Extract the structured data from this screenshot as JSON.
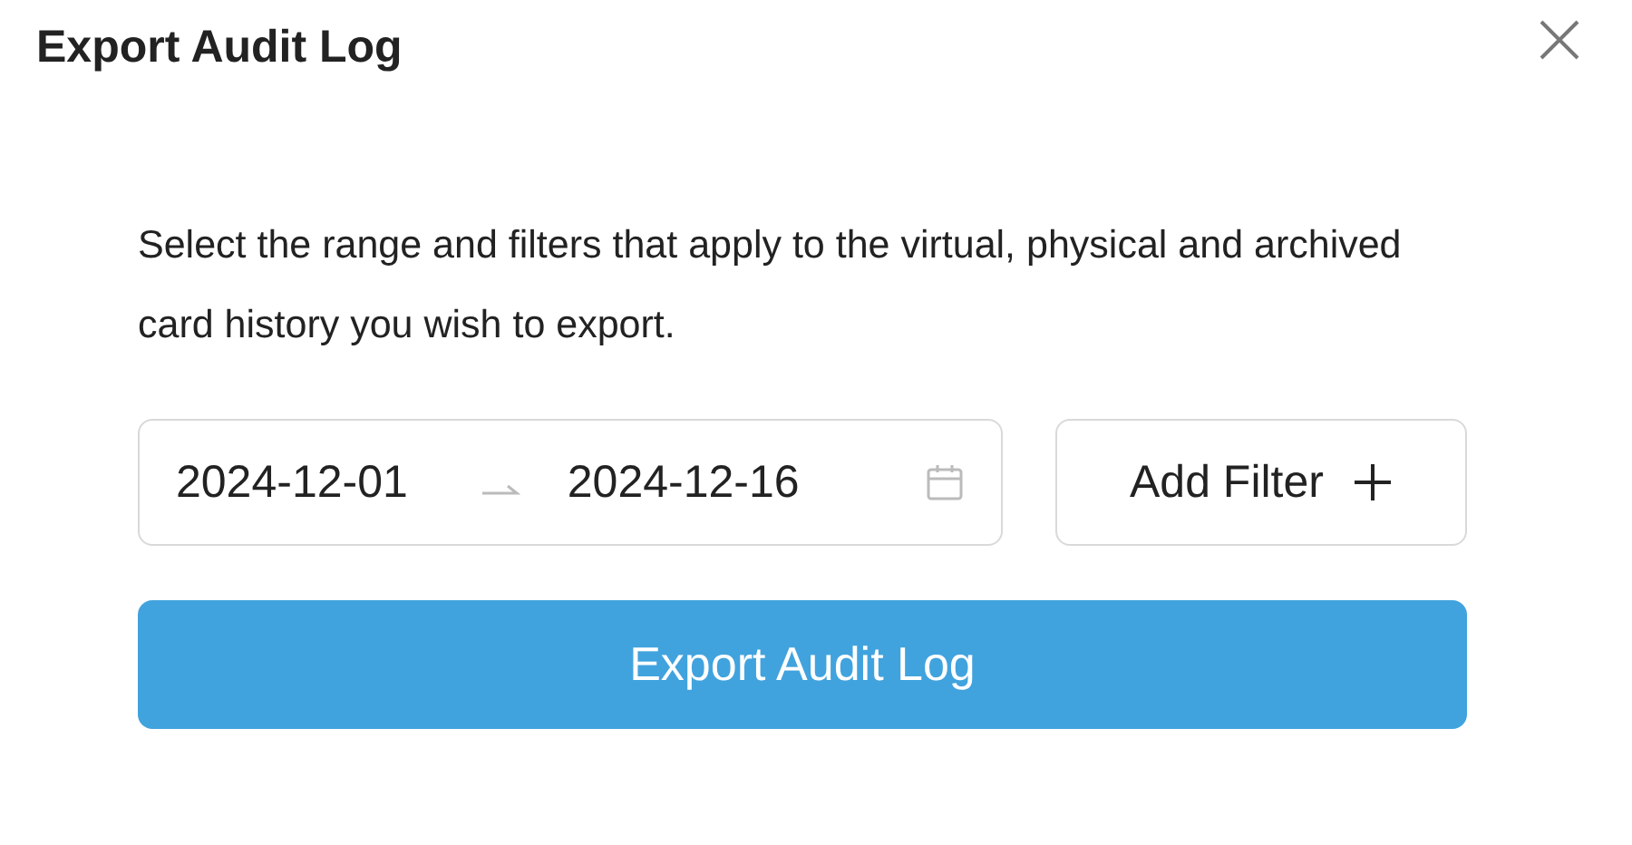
{
  "dialog": {
    "title": "Export Audit Log",
    "description": "Select the range and filters that apply to the virtual, physical and archived card history you wish to export."
  },
  "date_range": {
    "start": "2024-12-01",
    "end": "2024-12-16"
  },
  "add_filter_button": {
    "label": "Add Filter"
  },
  "export_button": {
    "label": "Export Audit Log"
  }
}
